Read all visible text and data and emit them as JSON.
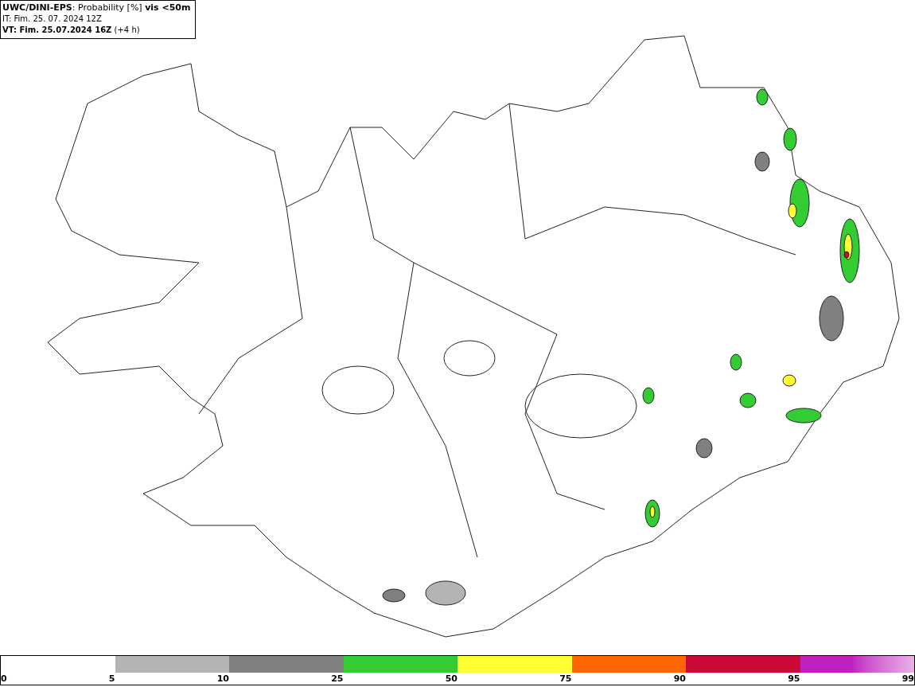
{
  "header": {
    "lines": [
      "**UWC/DINI-EPS**: Probability [%] **vis <50m**",
      "IT: Fim. 25. 07. 2024 12Z",
      "**VT: Fim. 25.07.2024 16Z** (+4 h)"
    ]
  },
  "legend": {
    "segments": [
      {
        "kind": "solid",
        "color": "#b4b4b4"
      },
      {
        "kind": "solid",
        "color": "#808080"
      },
      {
        "kind": "solid",
        "color": "#33cc33"
      },
      {
        "kind": "solid",
        "color": "#ffff33"
      },
      {
        "kind": "solid",
        "color": "#ff6600"
      },
      {
        "kind": "solid",
        "color": "#cc0a37"
      },
      {
        "kind": "gradient",
        "color": "#bf20c0"
      }
    ],
    "labels": [
      "0",
      "5",
      "10",
      "25",
      "50",
      "75",
      "90",
      "95",
      "99"
    ]
  }
}
